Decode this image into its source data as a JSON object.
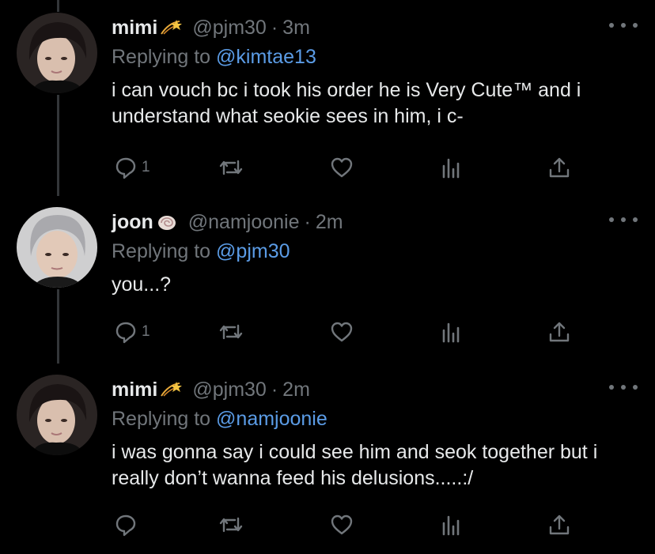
{
  "tweets": [
    {
      "name": "mimi",
      "name_emoji": "dizzy",
      "handle": "@pjm30",
      "time": "3m",
      "replying_prefix": "Replying to",
      "replying_to": "@kimtae13",
      "text": "i can vouch bc i took his order he is Very Cute™ and i understand what seokie sees in him, i c-",
      "reply_count": "1"
    },
    {
      "name": "joon",
      "name_emoji": "spiral-shell",
      "handle": "@namjoonie",
      "time": "2m",
      "replying_prefix": "Replying to",
      "replying_to": "@pjm30",
      "text": "you...?",
      "reply_count": "1"
    },
    {
      "name": "mimi",
      "name_emoji": "dizzy",
      "handle": "@pjm30",
      "time": "2m",
      "replying_prefix": "Replying to",
      "replying_to": "@namjoonie",
      "text": "i was gonna say i could see him and seok together but i really don’t wanna feed his delusions.....:/",
      "reply_count": ""
    }
  ],
  "separator": "·",
  "icons": {
    "reply": "reply-icon",
    "retweet": "retweet-icon",
    "like": "heart-icon",
    "analytics": "analytics-icon",
    "share": "share-icon",
    "more": "more-icon"
  },
  "colors": {
    "background": "#000000",
    "text": "#e7e9ea",
    "muted": "#71767b",
    "link": "#5b9ce6"
  }
}
